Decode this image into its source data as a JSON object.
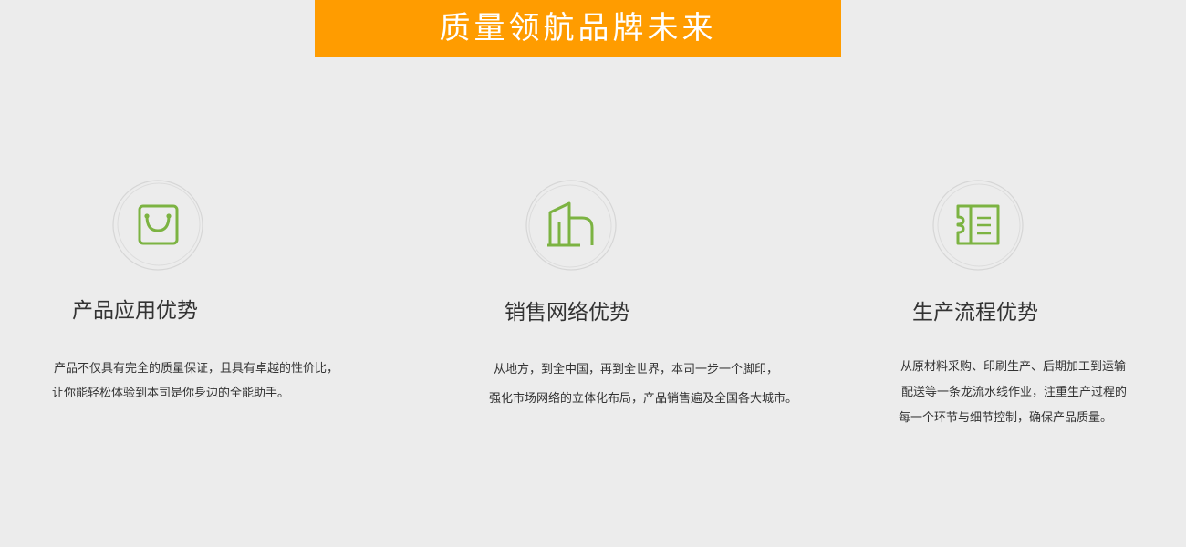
{
  "banner": {
    "title": "质量领航品牌未来"
  },
  "colors": {
    "accent": "#ff9c00",
    "icon_green": "#7cb342",
    "circle_gray": "#d6d6d6",
    "background": "#ececec"
  },
  "features": [
    {
      "icon": "shopping-bag-icon",
      "title": "产品应用优势",
      "lines": [
        "产品不仅具有完全的质量保证，且具有卓越的性价比，",
        "让你能轻松体验到本司是你身边的全能助手。"
      ]
    },
    {
      "icon": "buildings-icon",
      "title": "销售网络优势",
      "lines": [
        "从地方，到全中国，再到全世界，本司一步一个脚印，",
        "强化市场网络的立体化布局，产品销售遍及全国各大城市。"
      ]
    },
    {
      "icon": "ticket-icon",
      "title": "生产流程优势",
      "lines": [
        "从原材料采购、印刷生产、后期加工到运输",
        "配送等一条龙流水线作业，注重生产过程的",
        "每一个环节与细节控制，确保产品质量。"
      ]
    }
  ]
}
